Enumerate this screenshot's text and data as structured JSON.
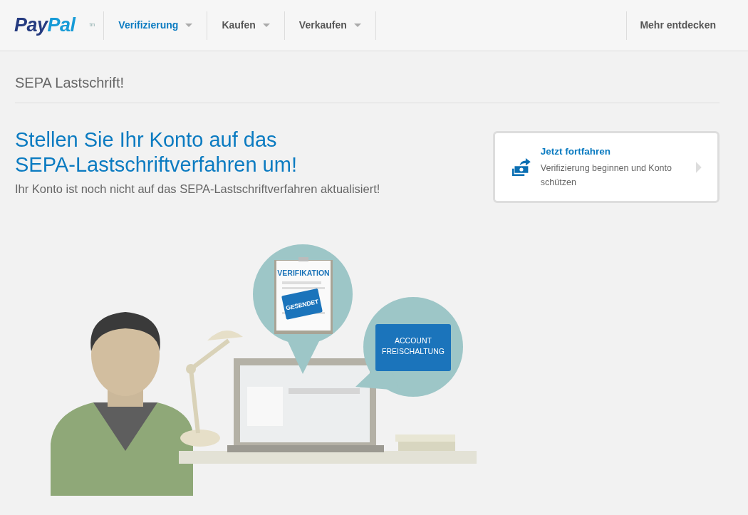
{
  "nav": {
    "logo": {
      "parts": [
        "Pay",
        "Pal"
      ],
      "mark": "tm"
    },
    "items": [
      {
        "label": "Verifizierung",
        "selected": true
      },
      {
        "label": "Kaufen",
        "selected": false
      },
      {
        "label": "Verkaufen",
        "selected": false
      }
    ],
    "right_link": "Mehr entdecken"
  },
  "page_title": "SEPA Lastschrift!",
  "headline": "Stellen Sie Ihr Konto auf das SEPA-Lastschriftverfahren um!",
  "subtext": "Ihr Konto ist noch nicht auf das SEPA-Lastschriftverfahren aktualisiert!",
  "action_card": {
    "title": "Jetzt fortfahren",
    "description": "Verifizierung beginnen und Konto schützen"
  },
  "illustration": {
    "clipboard_title": "VERIFIKATION",
    "stamp": "GESENDET",
    "bubble_label": [
      "ACCOUNT",
      "FREISCHALTUNG"
    ]
  }
}
